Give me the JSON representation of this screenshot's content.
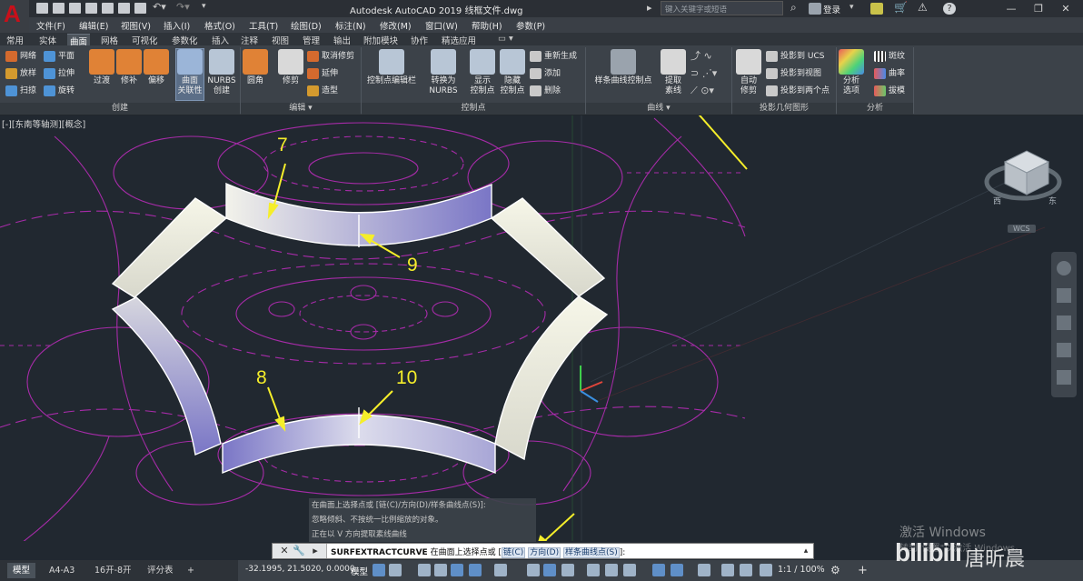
{
  "title_bar": {
    "window_title": "Autodesk AutoCAD 2019    线框文件.dwg",
    "search_placeholder": "键入关键字或短语",
    "login_label": "登录"
  },
  "menu_bar": [
    "文件(F)",
    "编辑(E)",
    "视图(V)",
    "插入(I)",
    "格式(O)",
    "工具(T)",
    "绘图(D)",
    "标注(N)",
    "修改(M)",
    "窗口(W)",
    "帮助(H)",
    "参数(P)"
  ],
  "ribbon_tabs": [
    "常用",
    "实体",
    "曲面",
    "网格",
    "可视化",
    "参数化",
    "插入",
    "注释",
    "视图",
    "管理",
    "输出",
    "附加模块",
    "协作",
    "精选应用"
  ],
  "ribbon_active_tab": "曲面",
  "ribbon": {
    "create_small": [
      "网络",
      "平面",
      "放样",
      "拉伸",
      "扫掠",
      "旋转"
    ],
    "create_big": [
      "过渡",
      "修补",
      "偏移"
    ],
    "assoc_label": [
      "曲面",
      "关联性"
    ],
    "nurbs_label": [
      "NURBS",
      "创建"
    ],
    "fillet_label": "圆角",
    "trim_label": "修剪",
    "edit_small": [
      "取消修剪",
      "延伸",
      "造型"
    ],
    "cv_edit_bar": "控制点编辑栏",
    "convert_nurbs": [
      "转换为",
      "NURBS"
    ],
    "show_cv": [
      "显示",
      "控制点"
    ],
    "hide_cv": [
      "隐藏",
      "控制点"
    ],
    "cv_small": [
      "重新生成",
      "添加",
      "删除"
    ],
    "spline_cv": "样条曲线控制点",
    "extract": [
      "提取",
      "素线"
    ],
    "auto_trim": [
      "自动",
      "修剪"
    ],
    "proj_small": [
      "投影到 UCS",
      "投影到视图",
      "投影到两个点"
    ],
    "analysis_big": [
      "分析",
      "选项"
    ],
    "analysis_small": [
      "斑纹",
      "曲率",
      "拔模"
    ],
    "panel_titles": {
      "create": "创建",
      "edit": "编辑 ▾",
      "control_points": "控制点",
      "curves": "曲线 ▾",
      "project": "投影几何图形",
      "analysis": "分析"
    }
  },
  "viewport_label": "[-][东南等轴测][概念]",
  "viewcube": {
    "left": "西",
    "right": "东",
    "label": "WCS"
  },
  "annotations": [
    "7",
    "9",
    "8",
    "10"
  ],
  "command_history": [
    "在曲面上选择点或 [链(C)/方向(D)/样条曲线点(S)]:",
    "忽略倾斜、不按统一比例缩放的对象。",
    "正在以 V 方向提取素线曲线"
  ],
  "command_line": {
    "command": "SURFEXTRACTCURVE",
    "prompt": "在曲面上选择点或 [",
    "opt1": "链(C)",
    "opt2": "方向(D)",
    "opt3": "样条曲线点(S)",
    "tail": "]:"
  },
  "layout_tabs": [
    "模型",
    "A4-A3",
    "16开-8开",
    "评分表"
  ],
  "status_bar": {
    "coords": "-32.1995, 21.5020, 0.0000",
    "model": "模型",
    "scale": "1:1 / 100%"
  },
  "watermark": {
    "line1": "激活 Windows",
    "line2": "转到\"设置\"以激活 Windows。",
    "brand": "bilibili",
    "author": "唐昕晨"
  },
  "colors": {
    "background": "#212830",
    "annotation": "#f5ee2a",
    "wireframe": "#c832c8",
    "surface_light": "#f4f4e6",
    "surface_blue": "#7b78c4"
  }
}
